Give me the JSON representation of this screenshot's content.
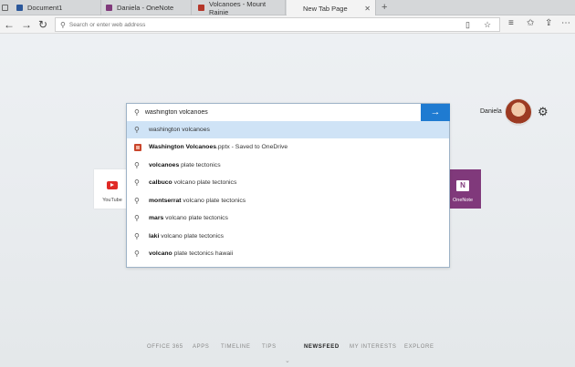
{
  "tabs": [
    {
      "title": "Document1",
      "color": "#2b579a",
      "active": false
    },
    {
      "title": "Daniela - OneNote",
      "color": "#80397b",
      "active": false
    },
    {
      "title": "Volcanoes - Mount Rainie",
      "color": "#b5372a",
      "active": false
    },
    {
      "title": "New Tab Page",
      "color": "",
      "active": true
    }
  ],
  "newtab_label": "+",
  "address_bar": {
    "placeholder": "Search or enter web address"
  },
  "user": {
    "name": "Daniela"
  },
  "tiles": {
    "youtube": "YouTube",
    "onenote": "OneNote"
  },
  "search": {
    "query": "washington volcanoes",
    "suggestions": [
      {
        "bold": "",
        "rest": "washington volcanoes",
        "type": "search",
        "highlighted": true
      },
      {
        "bold": "Washington Volcanoes",
        "rest": ".pptx - Saved to OneDrive",
        "type": "file",
        "highlighted": false
      },
      {
        "bold": "volcanoes",
        "rest": " plate tectonics",
        "type": "search",
        "highlighted": false
      },
      {
        "bold": "calbuco",
        "rest": " volcano plate tectonics",
        "type": "search",
        "highlighted": false
      },
      {
        "bold": "montserrat",
        "rest": " volcano plate tectonics",
        "type": "search",
        "highlighted": false
      },
      {
        "bold": "mars",
        "rest": " volcano plate tectonics",
        "type": "search",
        "highlighted": false
      },
      {
        "bold": "laki",
        "rest": " volcano plate tectonics",
        "type": "search",
        "highlighted": false
      },
      {
        "bold": "volcano",
        "rest": " plate tectonics hawaii",
        "type": "search",
        "highlighted": false
      }
    ]
  },
  "bottom_nav": [
    {
      "label": "OFFICE 365",
      "active": false
    },
    {
      "label": "APPS",
      "active": false
    },
    {
      "label": "TIMELINE",
      "active": false
    },
    {
      "label": "TIPS",
      "active": false
    },
    {
      "label": "NEWSFEED",
      "active": true
    },
    {
      "label": "MY INTERESTS",
      "active": false
    },
    {
      "label": "EXPLORE",
      "active": false
    }
  ],
  "colors": {
    "accent": "#1f7bd1",
    "highlight": "#cfe3f6"
  }
}
